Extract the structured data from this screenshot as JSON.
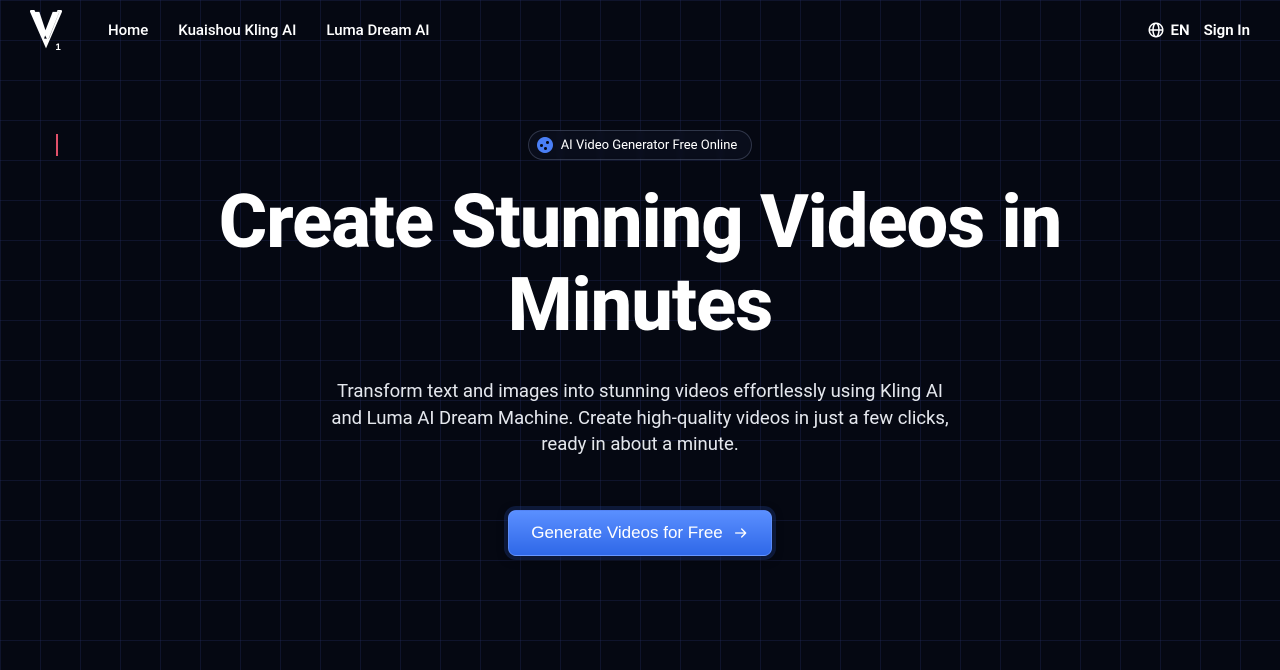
{
  "header": {
    "nav": [
      {
        "label": "Home"
      },
      {
        "label": "Kuaishou Kling AI"
      },
      {
        "label": "Luma Dream AI"
      }
    ],
    "language": "EN",
    "sign_in": "Sign In"
  },
  "hero": {
    "pill": "AI Video Generator Free Online",
    "title": "Create Stunning Videos in Minutes",
    "subtitle": "Transform text and images into stunning videos effortlessly using Kling AI and Luma AI Dream Machine. Create high-quality videos in just a few clicks, ready in about a minute.",
    "cta": "Generate Videos for Free"
  }
}
